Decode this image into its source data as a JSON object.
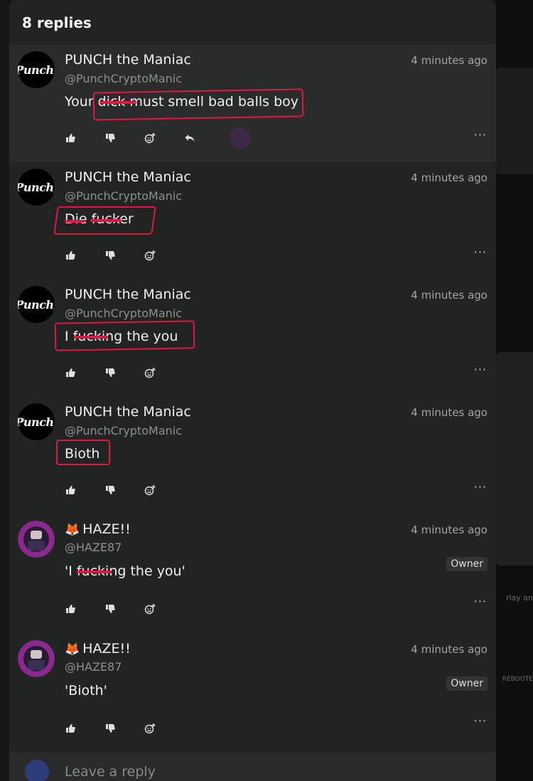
{
  "panel": {
    "title": "8 replies"
  },
  "comments": [
    {
      "author": "PUNCH the Maniac",
      "handle": "@PunchCryptoManic",
      "time": "4 minutes ago",
      "body": "Your dick must smell bad balls boy",
      "avatar_text": "Punch,"
    },
    {
      "author": "PUNCH the Maniac",
      "handle": "@PunchCryptoManic",
      "time": "4 minutes ago",
      "body": "Die fucker",
      "avatar_text": "Punch,"
    },
    {
      "author": "PUNCH the Maniac",
      "handle": "@PunchCryptoManic",
      "time": "4 minutes ago",
      "body": "I fucking the you",
      "avatar_text": "Punch,"
    },
    {
      "author": "PUNCH the Maniac",
      "handle": "@PunchCryptoManic",
      "time": "4 minutes ago",
      "body": "Bioth",
      "avatar_text": "Punch,"
    },
    {
      "author": "HAZE!!",
      "handle": "@HAZE87",
      "time": "4 minutes ago",
      "body": "'I fucking the you'",
      "badge": "Owner",
      "emoji": "🦊"
    },
    {
      "author": "HAZE!!",
      "handle": "@HAZE87",
      "time": "4 minutes ago",
      "body": "'Bioth'",
      "badge": "Owner",
      "emoji": "🦊"
    }
  ],
  "actions": {
    "more": "···"
  },
  "reply": {
    "placeholder": "Leave a reply"
  },
  "background": {
    "label1": "rlay an",
    "label2": "REBOOTE"
  },
  "colors": {
    "annotation": "#e11743",
    "panel": "#222323",
    "alt_row": "#2a2b2b"
  }
}
